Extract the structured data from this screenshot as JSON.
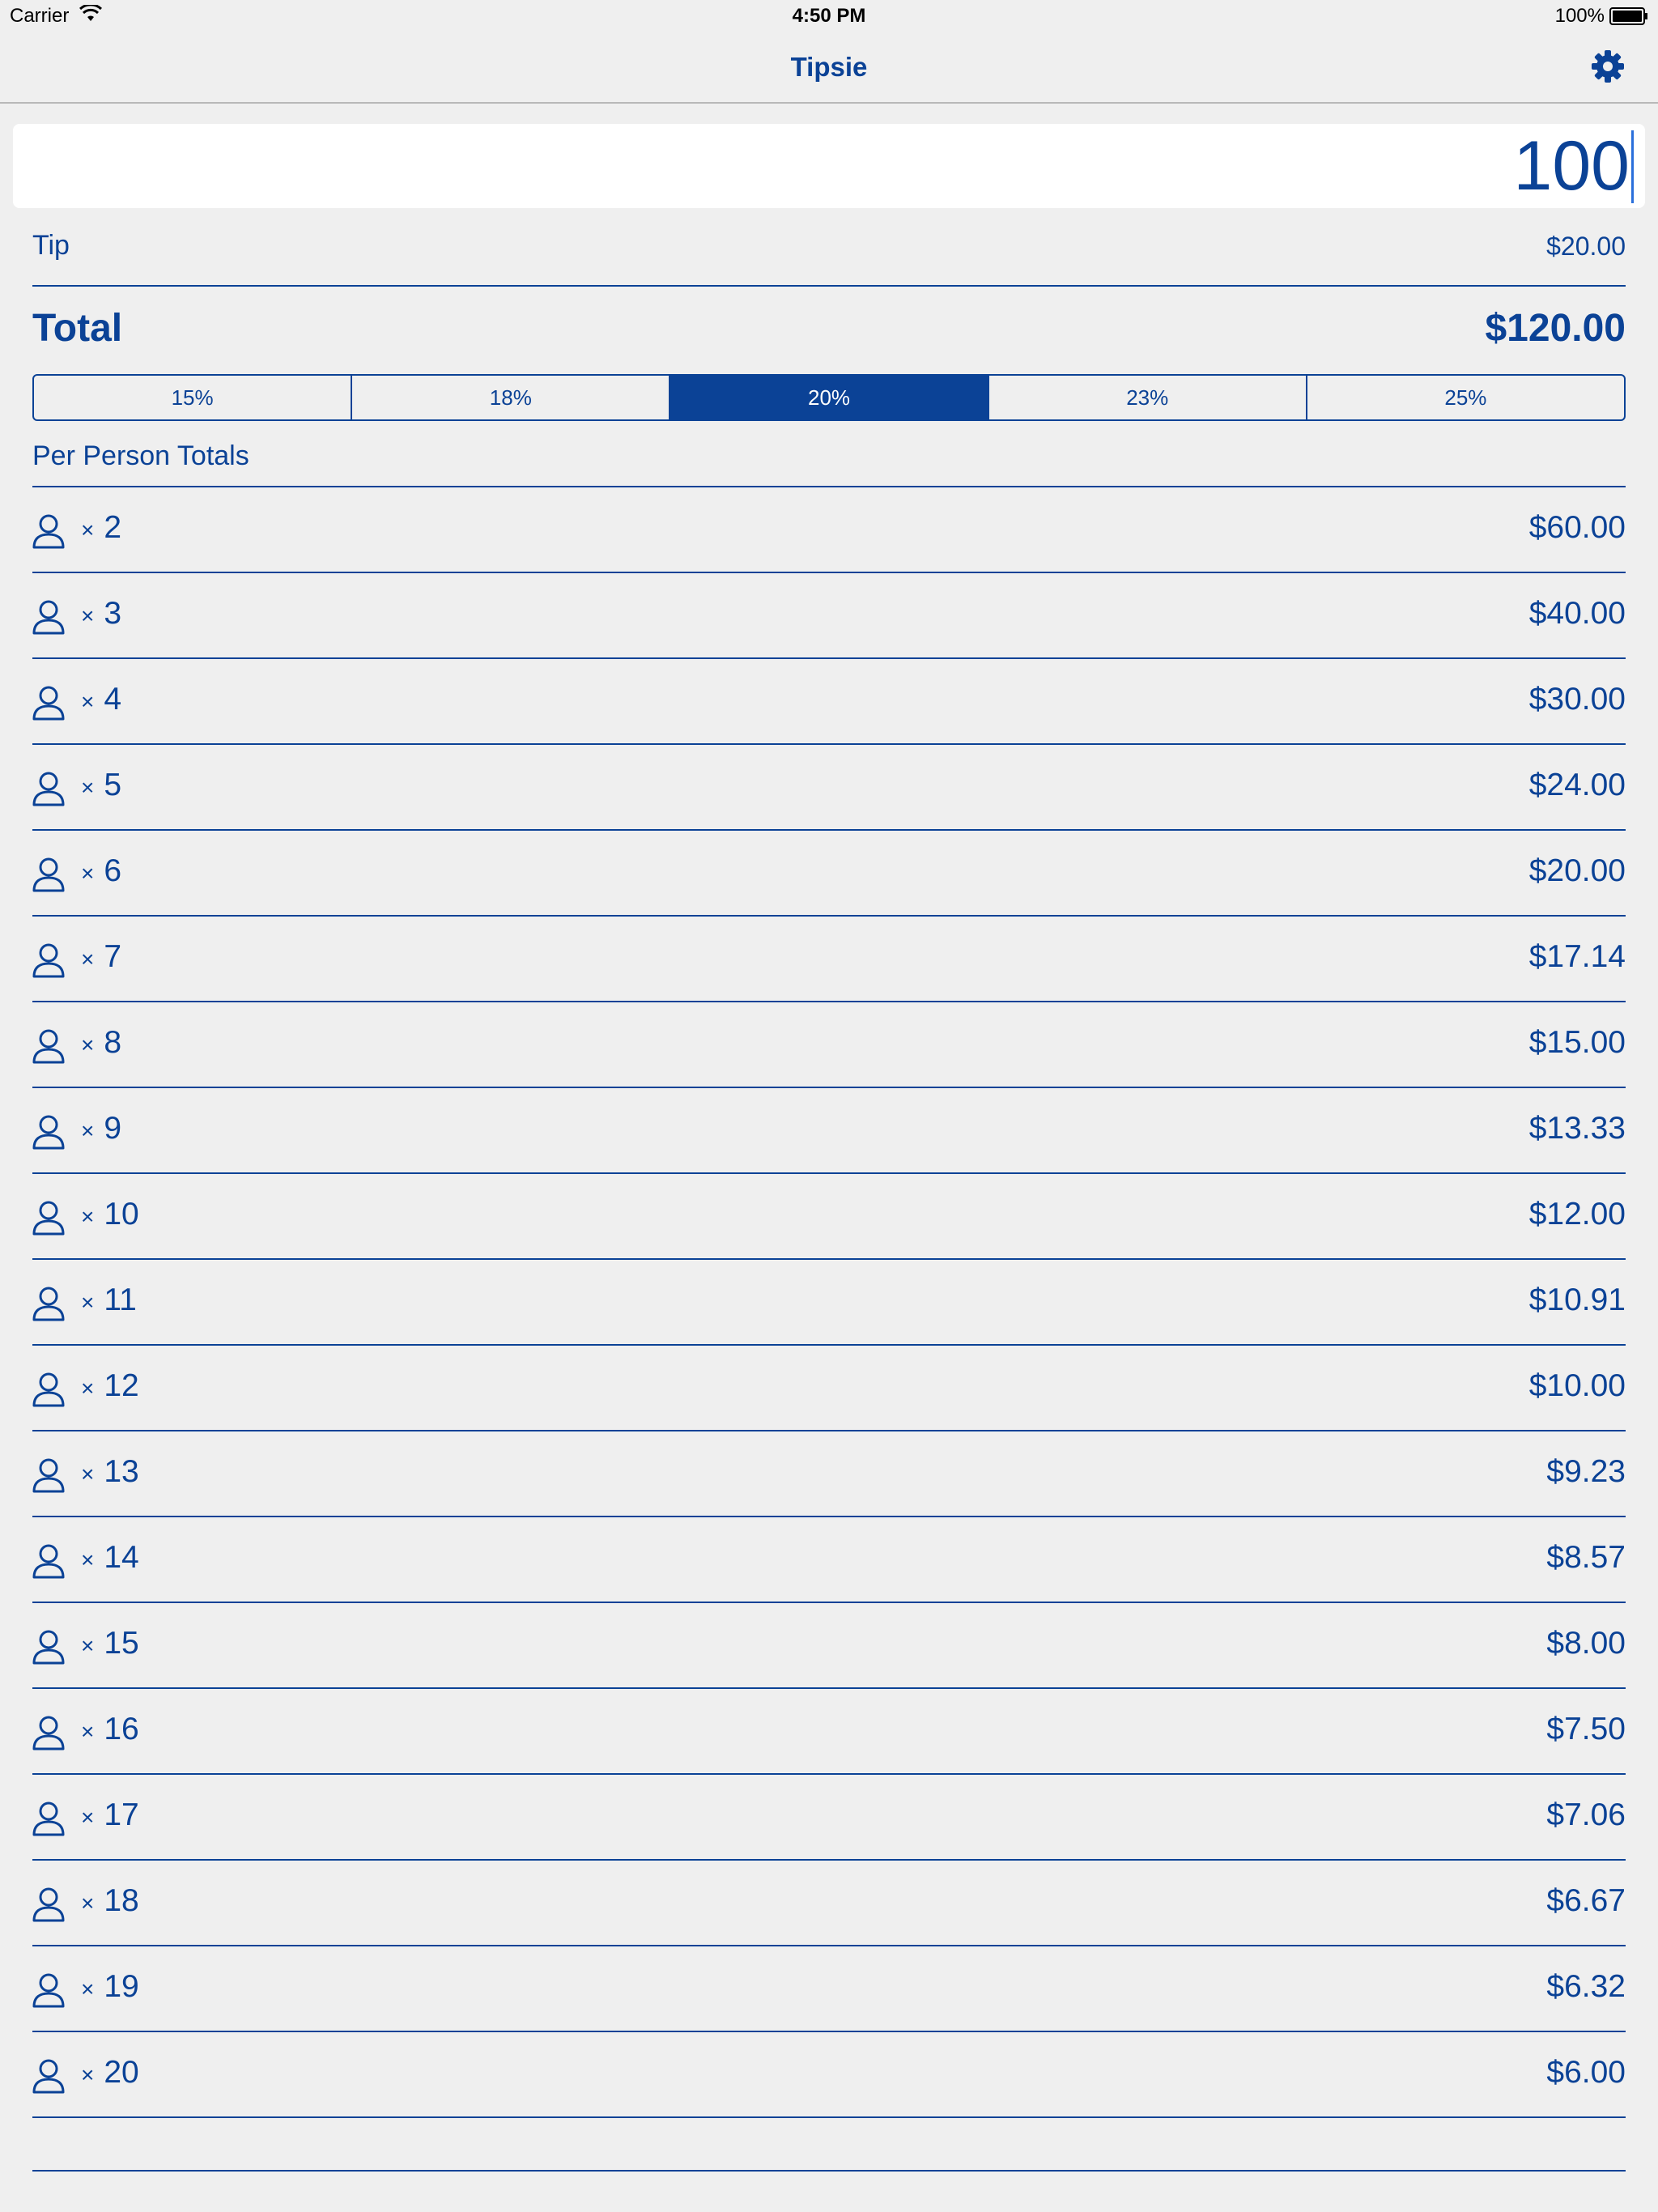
{
  "status_bar": {
    "carrier": "Carrier",
    "time": "4:50 PM",
    "battery": "100%"
  },
  "nav": {
    "title": "Tipsie",
    "settings_icon": "gear-icon"
  },
  "bill": {
    "value": "100"
  },
  "tip": {
    "label": "Tip",
    "value": "$20.00"
  },
  "total": {
    "label": "Total",
    "value": "$120.00"
  },
  "tip_options": [
    {
      "label": "15%",
      "selected": false
    },
    {
      "label": "18%",
      "selected": false
    },
    {
      "label": "20%",
      "selected": true
    },
    {
      "label": "23%",
      "selected": false
    },
    {
      "label": "25%",
      "selected": false
    }
  ],
  "per_person": {
    "header": "Per Person Totals",
    "times_symbol": "×",
    "rows": [
      {
        "count": "2",
        "amount": "$60.00"
      },
      {
        "count": "3",
        "amount": "$40.00"
      },
      {
        "count": "4",
        "amount": "$30.00"
      },
      {
        "count": "5",
        "amount": "$24.00"
      },
      {
        "count": "6",
        "amount": "$20.00"
      },
      {
        "count": "7",
        "amount": "$17.14"
      },
      {
        "count": "8",
        "amount": "$15.00"
      },
      {
        "count": "9",
        "amount": "$13.33"
      },
      {
        "count": "10",
        "amount": "$12.00"
      },
      {
        "count": "11",
        "amount": "$10.91"
      },
      {
        "count": "12",
        "amount": "$10.00"
      },
      {
        "count": "13",
        "amount": "$9.23"
      },
      {
        "count": "14",
        "amount": "$8.57"
      },
      {
        "count": "15",
        "amount": "$8.00"
      },
      {
        "count": "16",
        "amount": "$7.50"
      },
      {
        "count": "17",
        "amount": "$7.06"
      },
      {
        "count": "18",
        "amount": "$6.67"
      },
      {
        "count": "19",
        "amount": "$6.32"
      },
      {
        "count": "20",
        "amount": "$6.00"
      }
    ]
  },
  "colors": {
    "accent": "#0b4296",
    "background": "#efefef",
    "input_background": "#ffffff"
  }
}
